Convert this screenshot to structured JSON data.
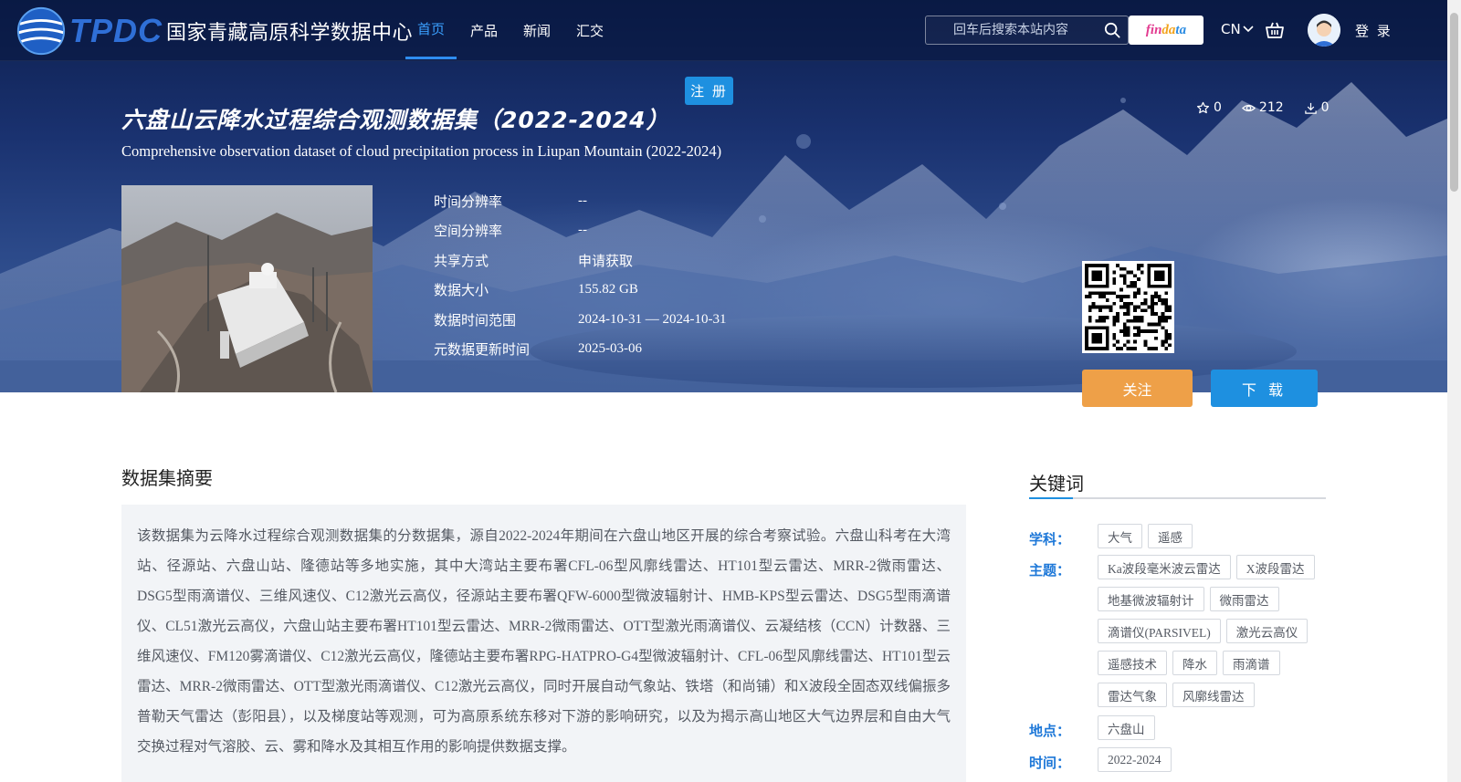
{
  "header": {
    "logo_abbr": "TPDC",
    "logo_name": "国家青藏高原科学数据中心",
    "nav": [
      {
        "label": "首页"
      },
      {
        "label": "产品"
      },
      {
        "label": "新闻"
      },
      {
        "label": "汇交"
      }
    ],
    "search_placeholder": "回车后搜索本站内容",
    "findata": {
      "part1": "fin",
      "part2": "da",
      "part3": "ta"
    },
    "lang": "CN",
    "login": "登 录",
    "register": "注 册"
  },
  "dataset": {
    "title_cn": "六盘山云降水过程综合观测数据集（2022-2024）",
    "title_en": "Comprehensive observation dataset of cloud precipitation process in Liupan Mountain (2022-2024)",
    "stats": {
      "stars": "0",
      "views": "212",
      "downloads": "0"
    },
    "meta": [
      {
        "label": "时间分辨率",
        "value": "--"
      },
      {
        "label": "空间分辨率",
        "value": "--"
      },
      {
        "label": "共享方式",
        "value": "申请获取"
      },
      {
        "label": "数据大小",
        "value": "155.82 GB"
      },
      {
        "label": "数据时间范围",
        "value": "2024-10-31 — 2024-10-31"
      },
      {
        "label": "元数据更新时间",
        "value": "2025-03-06"
      }
    ],
    "follow": "关注",
    "download": "下 载"
  },
  "abstract": {
    "title": "数据集摘要",
    "text": "该数据集为云降水过程综合观测数据集的分数据集，源自2022-2024年期间在六盘山地区开展的综合考察试验。六盘山科考在大湾站、径源站、六盘山站、隆德站等多地实施，其中大湾站主要布署CFL-06型风廓线雷达、HT101型云雷达、MRR-2微雨雷达、DSG5型雨滴谱仪、三维风速仪、C12激光云高仪，径源站主要布署QFW-6000型微波辐射计、HMB-KPS型云雷达、DSG5型雨滴谱仪、CL51激光云高仪，六盘山站主要布署HT101型云雷达、MRR-2微雨雷达、OTT型激光雨滴谱仪、云凝结核（CCN）计数器、三维风速仪、FM120雾滴谱仪、C12激光云高仪，隆德站主要布署RPG-HATPRO-G4型微波辐射计、CFL-06型风廓线雷达、HT101型云雷达、MRR-2微雨雷达、OTT型激光雨滴谱仪、C12激光云高仪，同时开展自动气象站、铁塔（和尚铺）和X波段全固态双线偏振多普勒天气雷达（彭阳县），以及梯度站等观测，可为高原系统东移对下游的影响研究，以及为揭示高山地区大气边界层和自由大气交换过程对气溶胶、云、雾和降水及其相互作用的影响提供数据支撑。"
  },
  "keywords": {
    "title": "关键词",
    "groups": [
      {
        "label": "学科：",
        "tags": [
          "大气",
          "遥感"
        ]
      },
      {
        "label": "主题：",
        "tags": [
          "Ka波段毫米波云雷达",
          "X波段雷达",
          "地基微波辐射计",
          "微雨雷达",
          "滴谱仪(PARSIVEL)",
          "激光云高仪",
          "遥感技术",
          "降水",
          "雨滴谱",
          "雷达气象",
          "风廓线雷达"
        ]
      },
      {
        "label": "地点：",
        "tags": [
          "六盘山"
        ]
      },
      {
        "label": "时间：",
        "tags": [
          "2022-2024"
        ]
      }
    ]
  }
}
